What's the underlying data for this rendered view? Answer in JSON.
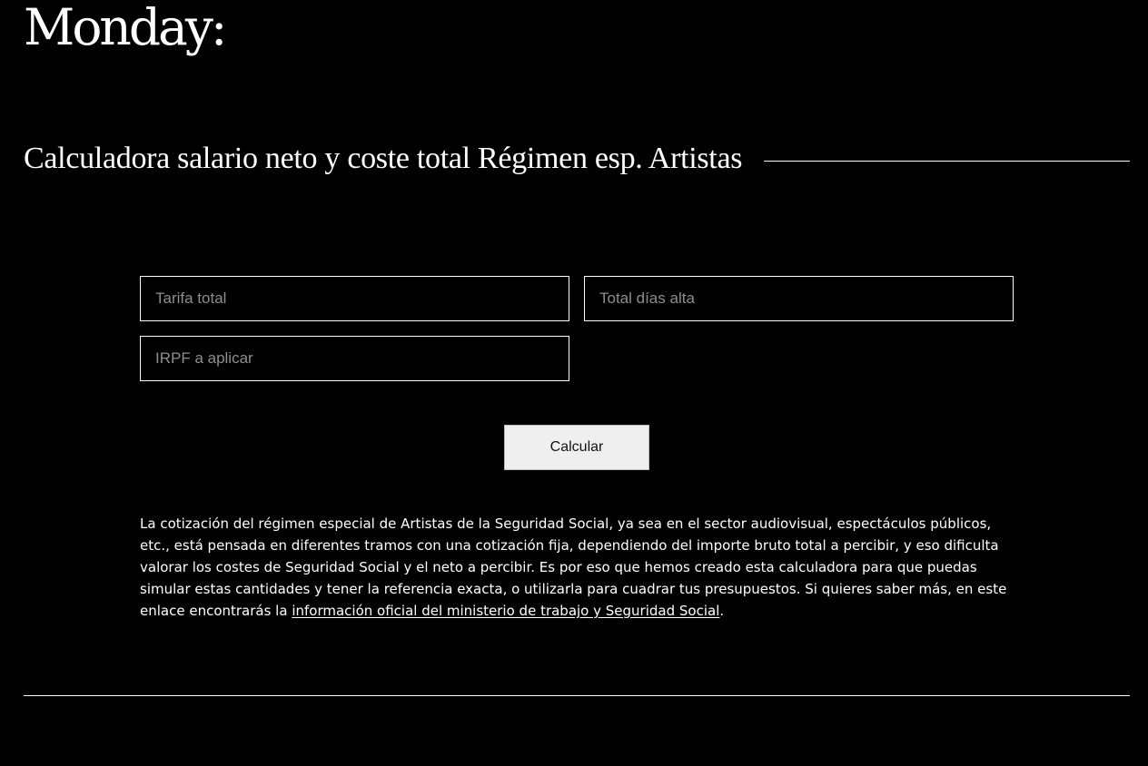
{
  "header": {
    "logo_text": "Monday:"
  },
  "calculator": {
    "title": "Calculadora salario neto y coste total Régimen esp. Artistas",
    "fields": [
      {
        "placeholder": "Tarifa total",
        "value": ""
      },
      {
        "placeholder": "Total días alta",
        "value": ""
      },
      {
        "placeholder": "IRPF a aplicar",
        "value": ""
      }
    ],
    "button_label": "Calcular"
  },
  "description": {
    "text": "La cotización del régimen especial de Artistas de la Seguridad Social, ya sea en el sector audiovisual, espectáculos públicos, etc., está pensada en diferentes tramos con una cotización fija, dependiendo del importe bruto total a percibir, y eso dificulta valorar los costes de Seguridad Social y el neto a percibir. Es por eso que hemos creado esta calculadora para que puedas simular estas cantidades y tener la referencia exacta, o utilizarla para cuadrar tus presupuestos. Si quieres saber más, en este enlace encontrarás la ",
    "link_text": "información oficial del ministerio de trabajo y Seguridad Social",
    "trailing": "."
  },
  "colors": {
    "background": "#000000",
    "foreground": "#ffffff",
    "placeholder": "#8e8e8e",
    "button_bg": "#efefef"
  }
}
